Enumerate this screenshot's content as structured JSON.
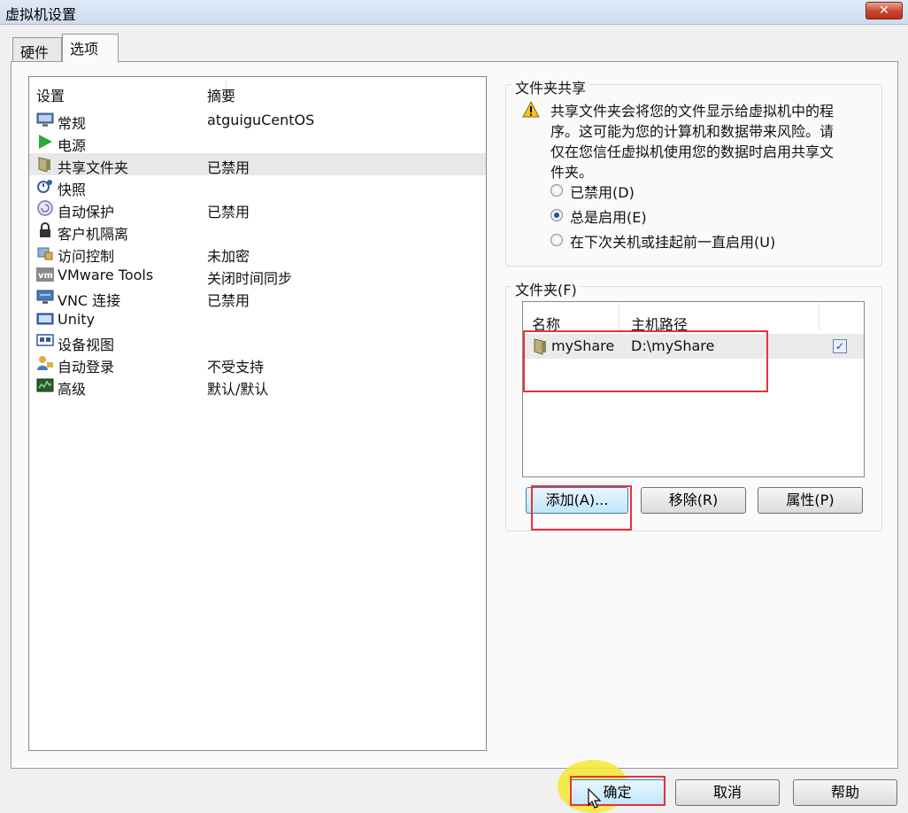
{
  "window": {
    "title": "虚拟机设置",
    "close_label": "✕"
  },
  "tabs": [
    {
      "label": "硬件"
    },
    {
      "label": "选项"
    }
  ],
  "settings": {
    "headers": {
      "setting": "设置",
      "summary": "摘要"
    },
    "items": [
      {
        "name": "常规",
        "summary": "atguiguCentOS",
        "icon": "monitor-icon"
      },
      {
        "name": "电源",
        "summary": "",
        "icon": "play-icon"
      },
      {
        "name": "共享文件夹",
        "summary": "已禁用",
        "icon": "shared-folder-icon"
      },
      {
        "name": "快照",
        "summary": "",
        "icon": "snapshot-icon"
      },
      {
        "name": "自动保护",
        "summary": "已禁用",
        "icon": "autoprotect-icon"
      },
      {
        "name": "客户机隔离",
        "summary": "",
        "icon": "lock-icon"
      },
      {
        "name": "访问控制",
        "summary": "未加密",
        "icon": "access-control-icon"
      },
      {
        "name": "VMware Tools",
        "summary": "关闭时间同步",
        "icon": "vmware-tools-icon"
      },
      {
        "name": "VNC 连接",
        "summary": "已禁用",
        "icon": "vnc-icon"
      },
      {
        "name": "Unity",
        "summary": "",
        "icon": "unity-icon"
      },
      {
        "name": "设备视图",
        "summary": "",
        "icon": "device-view-icon"
      },
      {
        "name": "自动登录",
        "summary": "不受支持",
        "icon": "autologin-icon"
      },
      {
        "name": "高级",
        "summary": "默认/默认",
        "icon": "advanced-icon"
      }
    ]
  },
  "shared_folders": {
    "title": "文件夹共享",
    "warning": "共享文件夹会将您的文件显示给虚拟机中的程序。这可能为您的计算机和数据带来风险。请仅在您信任虚拟机使用您的数据时启用共享文件夹。",
    "options": [
      {
        "label": "已禁用(D)",
        "selected": false
      },
      {
        "label": "总是启用(E)",
        "selected": true
      },
      {
        "label": "在下次关机或挂起前一直启用(U)",
        "selected": false
      }
    ]
  },
  "folders": {
    "title": "文件夹(F)",
    "headers": {
      "name": "名称",
      "host_path": "主机路径"
    },
    "rows": [
      {
        "name": "myShare",
        "host_path": "D:\\myShare",
        "checked": true,
        "check_mark": "✓"
      }
    ],
    "buttons": {
      "add": "添加(A)...",
      "remove": "移除(R)",
      "properties": "属性(P)"
    }
  },
  "footer": {
    "ok": "确定",
    "cancel": "取消",
    "help": "帮助"
  },
  "colors": {
    "highlight_box": "#e8323a",
    "cursor_highlight": "#f5e830",
    "accent": "#1f4fa8"
  }
}
